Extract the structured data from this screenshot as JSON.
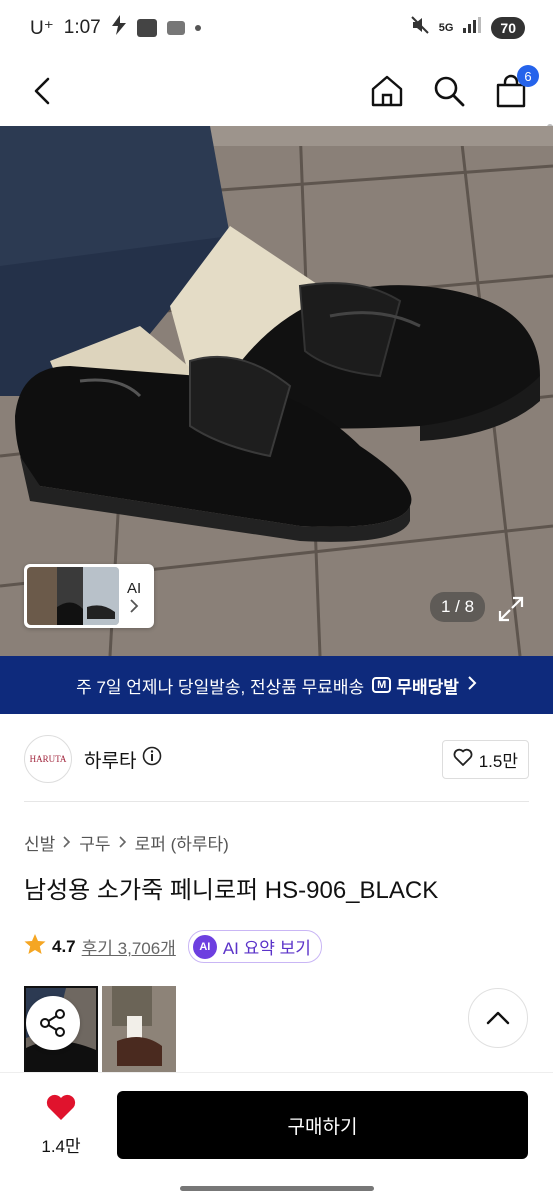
{
  "status_bar": {
    "carrier": "U⁺",
    "time": "1:07",
    "network": "5G",
    "battery": "70",
    "icons": [
      "flash-icon",
      "app-badge-icon",
      "app-badge-icon",
      "dot-icon",
      "mute-icon",
      "network-5g-icon",
      "signal-icon",
      "battery-icon"
    ]
  },
  "header": {
    "icons": [
      "back-arrow-icon",
      "home-icon",
      "search-icon",
      "shopping-bag-icon"
    ],
    "cart_count": "6"
  },
  "gallery": {
    "thumbnail_label": "AI",
    "page_counter": "1 / 8",
    "icons": [
      "chevron-right-icon",
      "expand-icon"
    ]
  },
  "banner": {
    "text": "주 7일 언제나 당일발송, 전상품 무료배송",
    "brand_mark": "M",
    "brand_text": "무배당발",
    "icons": [
      "chevron-right-icon"
    ]
  },
  "shop": {
    "logo_text": "HARUTA",
    "name": "하루타",
    "like_count": "1.5만",
    "icons": [
      "info-icon",
      "heart-outline-icon"
    ]
  },
  "breadcrumb": [
    "신발",
    "구두",
    "로퍼 (하루타)"
  ],
  "product": {
    "title": "남성용 소가죽 페니로퍼 HS-906_BLACK",
    "rating": "4.7",
    "review_text": "후기 3,706개",
    "ai_badge": "AI",
    "ai_summary_label": "AI 요약 보기"
  },
  "floating": {
    "icons": [
      "share-icon",
      "chevron-up-icon"
    ]
  },
  "bottom_bar": {
    "wish_count": "1.4만",
    "buy_label": "구매하기",
    "icons": [
      "heart-filled-icon"
    ]
  },
  "colors": {
    "banner_bg": "#0e2a7c",
    "cart_badge": "#2563eb",
    "heart": "#e0132d",
    "star": "#f5a623",
    "ai_purple": "#6d3fe0",
    "buy_button": "#000000"
  }
}
